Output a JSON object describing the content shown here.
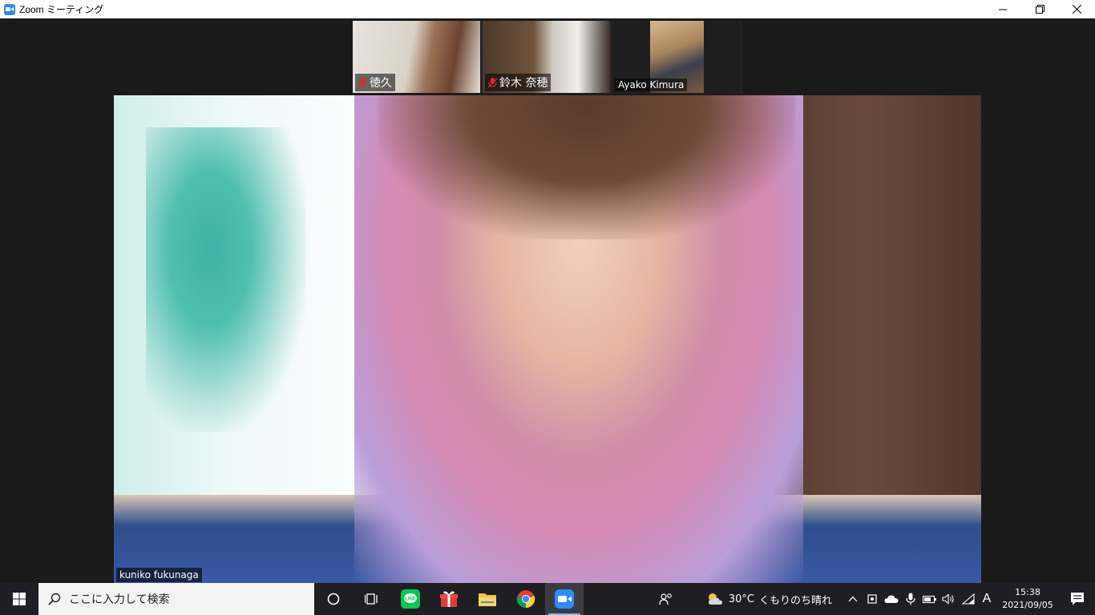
{
  "window": {
    "title": "Zoom ミーティング",
    "accent": "#2d8cff"
  },
  "participants": [
    {
      "name": "徳久",
      "muted": true
    },
    {
      "name": "鈴木 奈穂",
      "muted": true
    },
    {
      "name": "Ayako Kimura",
      "muted": false
    }
  ],
  "active_speaker": {
    "name": "kuniko fukunaga"
  },
  "taskbar": {
    "search_placeholder": "ここに入力して検索",
    "apps": [
      "cortana-icon",
      "task-view-icon",
      "line-app-icon",
      "gift-app-icon",
      "file-explorer-icon",
      "chrome-icon",
      "zoom-app-icon"
    ],
    "weather_temp": "30°C",
    "weather_text": "くもりのち晴れ",
    "ime": "A",
    "time": "15:38",
    "date": "2021/09/05"
  }
}
